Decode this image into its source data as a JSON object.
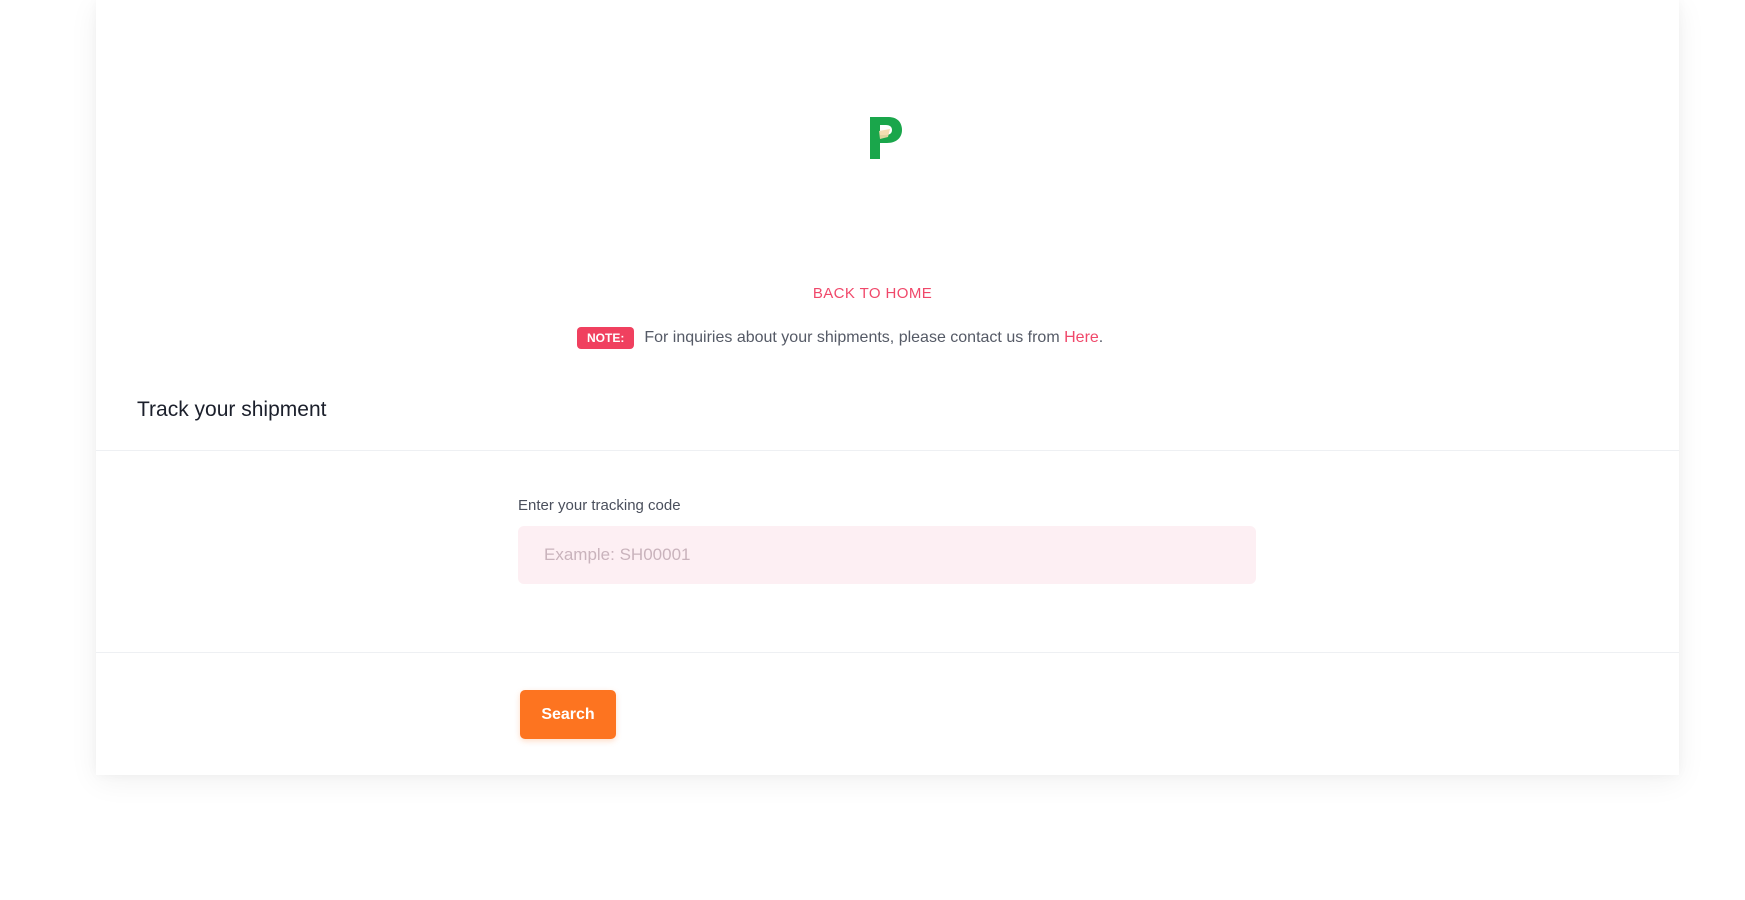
{
  "header": {
    "logo_icon": "p-logo-icon",
    "back_home_label": "BACK TO HOME",
    "note": {
      "badge": "NOTE:",
      "text": "For inquiries about your shipments, please contact us from",
      "link_label": "Here",
      "suffix": "."
    }
  },
  "form": {
    "title": "Track your shipment",
    "tracking_label": "Enter your tracking code",
    "tracking_placeholder": "Example: SH00001",
    "tracking_value": "",
    "search_label": "Search"
  },
  "colors": {
    "accent_pink": "#f0486a",
    "badge_red": "#f0405f",
    "button_orange": "#fd7420",
    "input_bg": "#fdeff3",
    "logo_green": "#1aa64b"
  }
}
